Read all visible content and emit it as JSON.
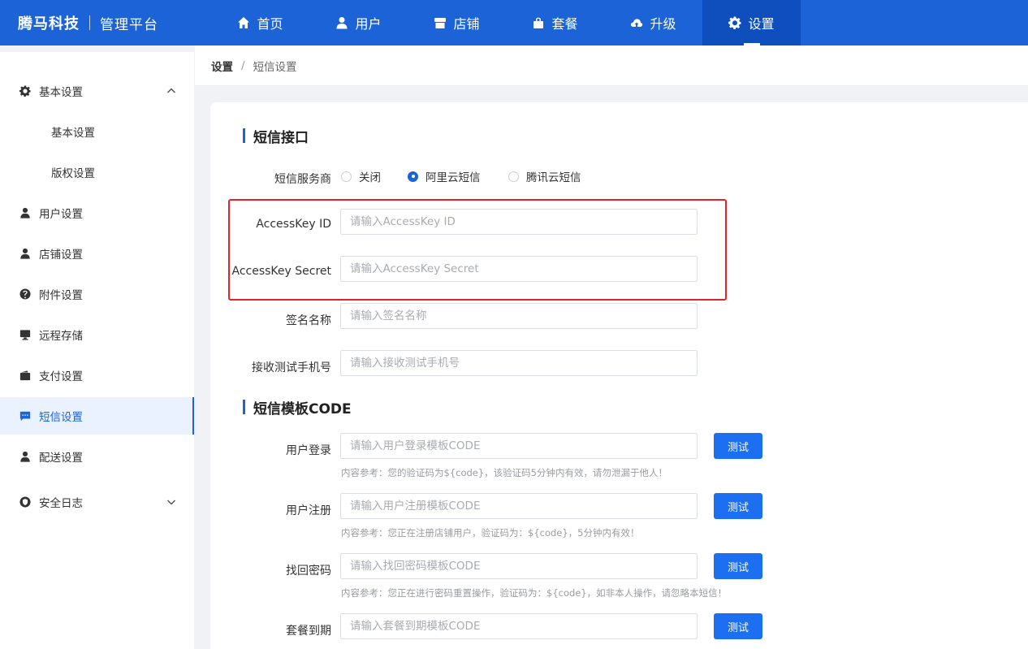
{
  "header": {
    "brand": "腾马科技",
    "subtitle": "管理平台",
    "nav": [
      {
        "label": "首页",
        "icon": "home-icon"
      },
      {
        "label": "用户",
        "icon": "user-icon"
      },
      {
        "label": "店铺",
        "icon": "store-icon"
      },
      {
        "label": "套餐",
        "icon": "bag-icon"
      },
      {
        "label": "升级",
        "icon": "cloud-upload-icon"
      },
      {
        "label": "设置",
        "icon": "gear-icon",
        "active": true
      }
    ]
  },
  "sidebar": {
    "items": [
      {
        "label": "基本设置",
        "icon": "gear-icon",
        "expanded": true
      },
      {
        "label": "基本设置"
      },
      {
        "label": "版权设置"
      },
      {
        "label": "用户设置",
        "icon": "user-icon"
      },
      {
        "label": "店铺设置",
        "icon": "user-icon"
      },
      {
        "label": "附件设置",
        "icon": "help-circle-icon"
      },
      {
        "label": "远程存储",
        "icon": "monitor-icon"
      },
      {
        "label": "支付设置",
        "icon": "wallet-icon"
      },
      {
        "label": "短信设置",
        "icon": "message-icon",
        "active": true
      },
      {
        "label": "配送设置",
        "icon": "user-icon"
      },
      {
        "label": "安全日志",
        "icon": "shield-icon",
        "expanded": false
      }
    ]
  },
  "breadcrumb": {
    "root": "设置",
    "separator": "/",
    "current": "短信设置"
  },
  "sms_api": {
    "title": "短信接口",
    "provider_label": "短信服务商",
    "providers": [
      {
        "label": "关闭",
        "checked": false
      },
      {
        "label": "阿里云短信",
        "checked": true
      },
      {
        "label": "腾讯云短信",
        "checked": false
      }
    ],
    "fields": [
      {
        "label": "AccessKey ID",
        "placeholder": "请输入AccessKey ID",
        "value": ""
      },
      {
        "label": "AccessKey Secret",
        "placeholder": "请输入AccessKey Secret",
        "value": ""
      },
      {
        "label": "签名名称",
        "placeholder": "请输入签名名称",
        "value": ""
      },
      {
        "label": "接收测试手机号",
        "placeholder": "请输入接收测试手机号",
        "value": ""
      }
    ]
  },
  "sms_templates": {
    "title": "短信模板CODE",
    "test_label": "测试",
    "items": [
      {
        "label": "用户登录",
        "placeholder": "请输入用户登录模板CODE",
        "hint": "内容参考：您的验证码为${code}，该验证码5分钟内有效，请勿泄漏于他人！"
      },
      {
        "label": "用户注册",
        "placeholder": "请输入用户注册模板CODE",
        "hint": "内容参考：您正在注册店铺用户，验证码为：${code}，5分钟内有效！"
      },
      {
        "label": "找回密码",
        "placeholder": "请输入找回密码模板CODE",
        "hint": "内容参考：您正在进行密码重置操作，验证码为：${code}，如非本人操作，请忽略本短信！"
      },
      {
        "label": "套餐到期",
        "placeholder": "请输入套餐到期模板CODE",
        "hint": ""
      }
    ]
  },
  "colors": {
    "primary": "#1b63d6",
    "button": "#1b6ff0",
    "highlight": "#e0242a"
  }
}
